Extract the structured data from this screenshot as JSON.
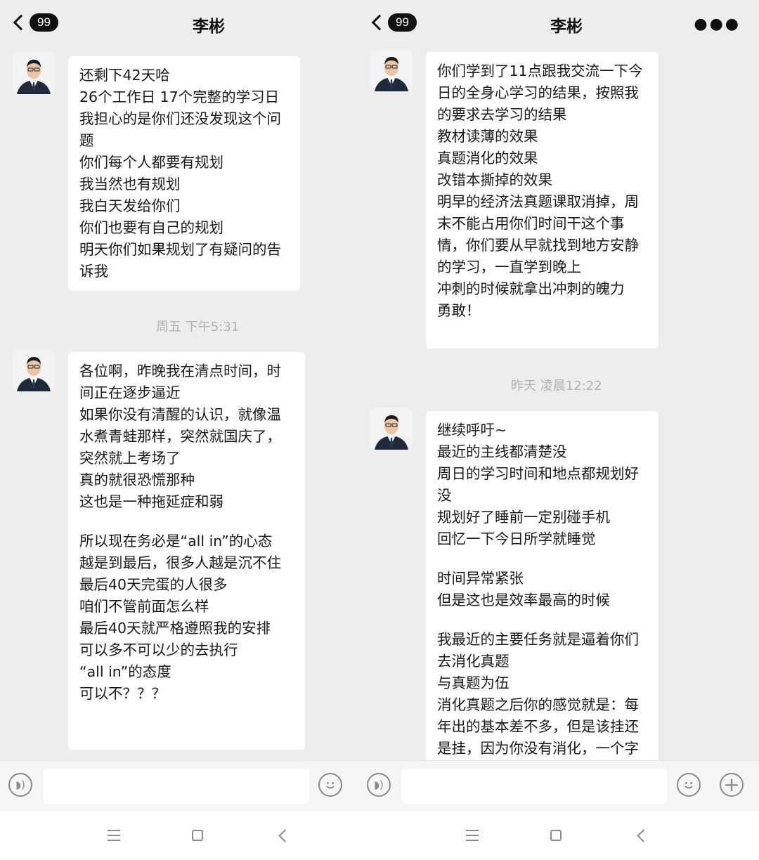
{
  "left": {
    "header": {
      "badge": "99",
      "title": "李彬"
    },
    "messages": [
      {
        "lines": [
          "还剩下42天哈",
          "26个工作日  17个完整的学习日",
          "我担心的是你们还没发现这个问",
          "题",
          "你们每个人都要有规划",
          "我当然也有规划",
          "我白天发给你们",
          "你们也要有自己的规划",
          "明天你们如果规划了有疑问的告",
          "诉我"
        ]
      },
      {
        "lines": [
          "各位啊，昨晚我在清点时间，时",
          "间正在逐步逼近",
          "如果你没有清醒的认识，就像温",
          "水煮青蛙那样，突然就国庆了，",
          "突然就上考场了",
          "真的就很恐慌那种",
          "这也是一种拖延症和弱"
        ]
      },
      {
        "lines": [
          "所以现在务必是“all in”的心态",
          "越是到最后，很多人越是沉不住",
          "最后40天完蛋的人很多",
          "咱们不管前面怎么样",
          "最后40天就严格遵照我的安排",
          "可以多不可以少的去执行",
          "“all in”的态度",
          "可以不？？？"
        ]
      }
    ],
    "timestamp": "周五 下午5:31"
  },
  "right": {
    "header": {
      "badge": "99",
      "title": "李彬"
    },
    "messages": [
      {
        "lines": [
          "你们学到了11点跟我交流一下今",
          "日的全身心学习的结果，按照我",
          "的要求去学习的结果",
          "教材读薄的效果",
          "真题消化的效果",
          "改错本撕掉的效果",
          "明早的经济法真题课取消掉，周",
          "末不能占用你们时间干这个事",
          "情，你们要从早就找到地方安静",
          "的学习，一直学到晚上",
          "冲刺的时候就拿出冲刺的魄力",
          "勇敢！"
        ]
      },
      {
        "lines": [
          "继续呼吁~",
          "最近的主线都清楚没",
          "周日的学习时间和地点都规划好",
          "没",
          "规划好了睡前一定别碰手机",
          "回忆一下今日所学就睡觉"
        ]
      },
      {
        "lines": [
          "时间异常紧张",
          "但是这也是效率最高的时候"
        ]
      },
      {
        "lines": [
          "我最近的主要任务就是逼着你们",
          "去消化真题",
          "与真题为伍",
          "消化真题之后你的感觉就是：每",
          "年出的基本差不多，但是该挂还",
          "是挂，因为你没有消化，一个字"
        ]
      }
    ],
    "timestamp": "昨天 凌晨12:22"
  }
}
